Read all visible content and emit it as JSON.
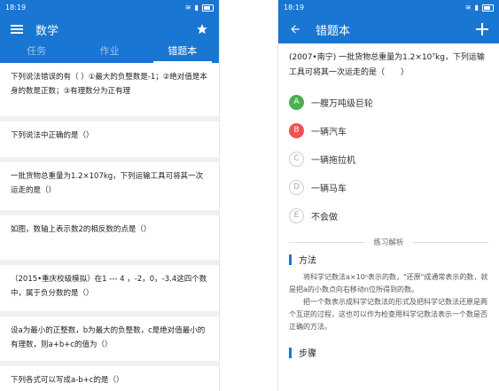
{
  "left": {
    "status_time": "18:19",
    "title": "数学",
    "tabs": [
      "任务",
      "作业",
      "错题本"
    ],
    "questions": [
      "下列说法错误的有（ ）①最大的负整数是-1；②绝对值是本身的数是正数；③有理数分为正有理",
      "下列说法中正确的是（）",
      "一批货物总重量为1.2×107kg，下列运输工具可将其一次运走的是（）",
      "如图，数轴上表示数2的相反数的点是（）",
      "（2015•重庆校级模拟）在1 --- 4 ，-2，0，-3.4这四个数中，属于负分数的是（）",
      "设a为最小的正整数，b为最大的负整数，c是绝对值最小的有理数，则a+b+c的值为（）",
      "下列各式可以写成a-b+c的是（）"
    ]
  },
  "right": {
    "status_time": "18:19",
    "title": "错题本",
    "question": "(2007•南宁) 一批货物总重量为1.2×10⁷kg，下列运输工具可将其一次运走的是（　　）",
    "options": [
      {
        "letter": "A",
        "text": "一艘万吨级巨轮",
        "state": "correct"
      },
      {
        "letter": "B",
        "text": "一辆汽车",
        "state": "wrong"
      },
      {
        "letter": "C",
        "text": "一辆拖拉机",
        "state": "normal"
      },
      {
        "letter": "D",
        "text": "一辆马车",
        "state": "normal"
      },
      {
        "letter": "E",
        "text": "不会做",
        "state": "normal"
      }
    ],
    "divider": "练习解析",
    "method_title": "方法",
    "method_p1": "将科学记数法a×10ⁿ表示的数，\"还原\"成通常表示的数，就是把a的小数点向右移动n位所得到的数。",
    "method_p2": "把一个数表示成科学记数法的形式及把科学记数法还原是两个互逆的过程，这也可以作为检查用科学记数法表示一个数是否正确的方法。",
    "steps_title": "步骤"
  },
  "colors": {
    "primary": "#1976d2",
    "correct": "#4caf50",
    "wrong": "#ef5350"
  }
}
